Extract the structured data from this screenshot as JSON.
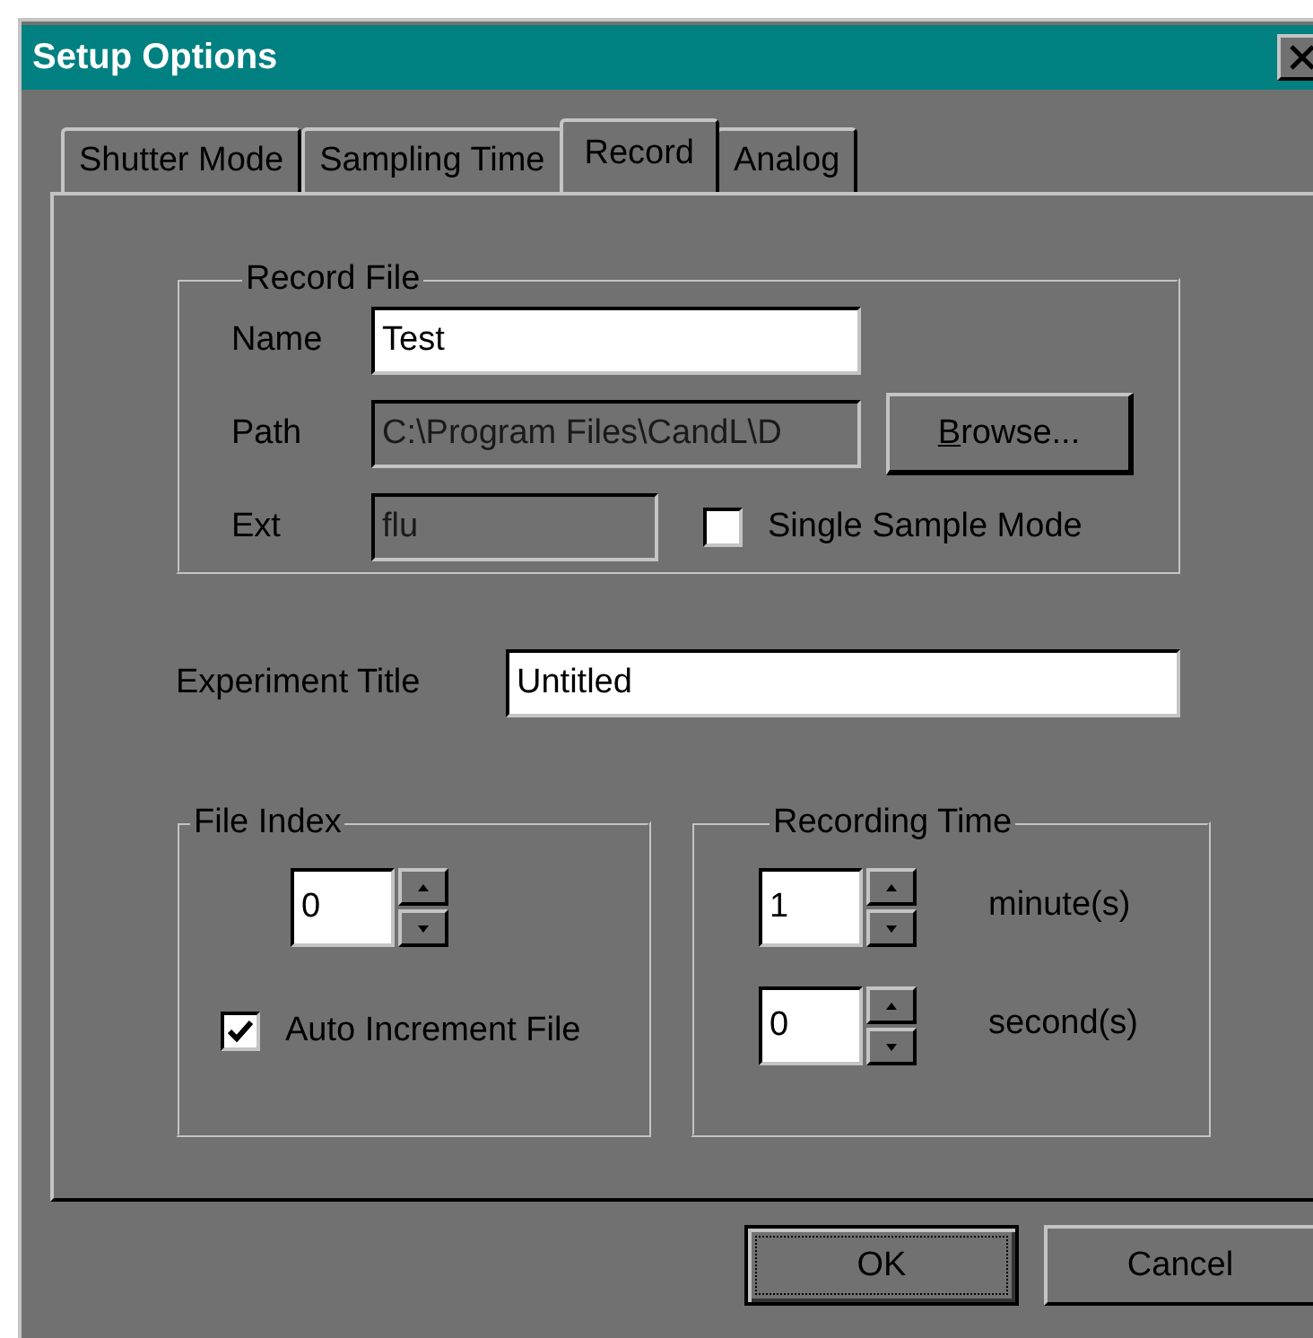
{
  "window": {
    "title": "Setup Options"
  },
  "tabs": [
    {
      "label": "Shutter Mode",
      "selected": false
    },
    {
      "label": "Sampling Time",
      "selected": false
    },
    {
      "label": "Record",
      "selected": true
    },
    {
      "label": "Analog",
      "selected": false
    }
  ],
  "record_file": {
    "title": "Record File",
    "fields": [
      {
        "label": "Name",
        "value": "Test",
        "disabled": false
      },
      {
        "label": "Path",
        "value": "C:\\Program Files\\CandL\\D",
        "disabled": true
      },
      {
        "label": "Ext",
        "value": "flu",
        "disabled": true
      }
    ],
    "browse_button": "Browse...",
    "single_sample": {
      "label": "Single Sample Mode",
      "checked": false
    }
  },
  "experiment_title": {
    "label": "Experiment Title",
    "value": "Untitled"
  },
  "file_index": {
    "title": "File Index",
    "value": "0",
    "auto_increment": {
      "label": "Auto Increment File",
      "checked": true
    }
  },
  "recording_time": {
    "title": "Recording Time",
    "rows": [
      {
        "value": "1",
        "unit": "minute(s)"
      },
      {
        "value": "0",
        "unit": "second(s)"
      }
    ]
  },
  "buttons": [
    {
      "label": "OK",
      "default": true
    },
    {
      "label": "Cancel",
      "default": false
    }
  ]
}
